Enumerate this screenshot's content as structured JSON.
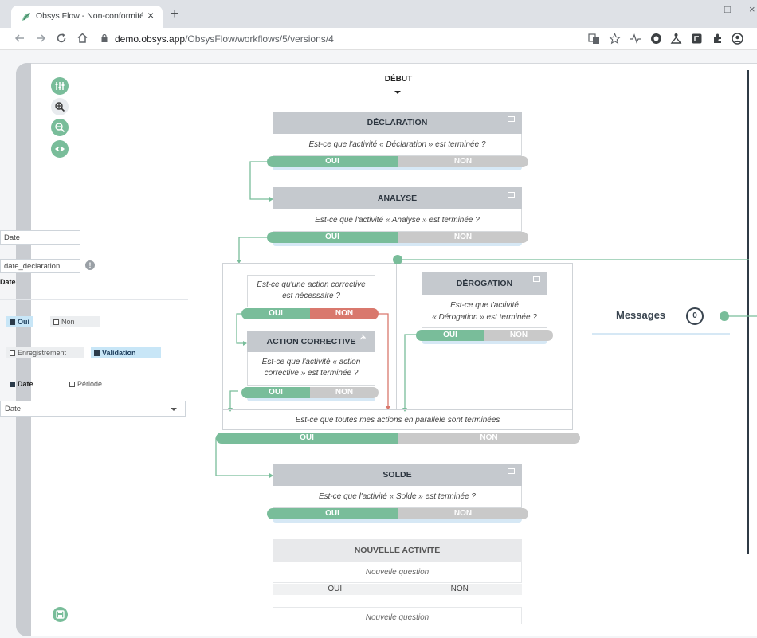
{
  "browser": {
    "tab_title": "Obsys Flow - Non-conformité Q",
    "tab_close": "×",
    "new_tab": "+",
    "url_host": "demo.obsys.app",
    "url_path": "/ObsysFlow/workflows/5/versions/4",
    "win_min": "–",
    "win_max": "□",
    "win_close": "×"
  },
  "panel": {
    "label_field": "Date",
    "key_field": "date_declaration",
    "info_glyph": "!",
    "section_label": "Date",
    "required_yes": "Oui",
    "required_no": "Non",
    "mode_record": "Enregistrement",
    "mode_validation": "Validation",
    "type_date": "Date",
    "type_period": "Période",
    "select_value": "Date"
  },
  "workflow": {
    "start": "DÉBUT",
    "yes": "OUI",
    "no": "NON",
    "nodes": {
      "declaration": {
        "title": "DÉCLARATION",
        "question": "Est-ce que l'activité « Déclaration » est terminée ?"
      },
      "analyse": {
        "title": "ANALYSE",
        "question": "Est-ce que l'activité « Analyse » est terminée ?"
      },
      "action_question": {
        "question_1": "Est-ce qu'une action corrective",
        "question_2": "est nécessaire ?"
      },
      "action": {
        "title": "ACTION CORRECTIVE",
        "question_1": "Est-ce que l'activité « action",
        "question_2": "corrective » est terminée ?"
      },
      "derogation": {
        "title": "DÉROGATION",
        "question_1": "Est-ce que l'activité",
        "question_2": "« Dérogation » est terminée ?"
      },
      "parallel": {
        "question": "Est-ce que toutes mes actions en parallèle sont terminées"
      },
      "solde": {
        "title": "SOLDE",
        "question": "Est-ce que l'activité « Solde » est terminée ?"
      },
      "new_activity": {
        "title": "NOUVELLE ACTIVITÉ",
        "question": "Nouvelle question",
        "question_2": "Nouvelle question"
      }
    }
  },
  "messages": {
    "label": "Messages",
    "count": "0"
  },
  "colors": {
    "accent": "#79bd9a",
    "danger": "#d9786d",
    "neutral": "#c9c9c9",
    "header": "#c5c9ce"
  }
}
